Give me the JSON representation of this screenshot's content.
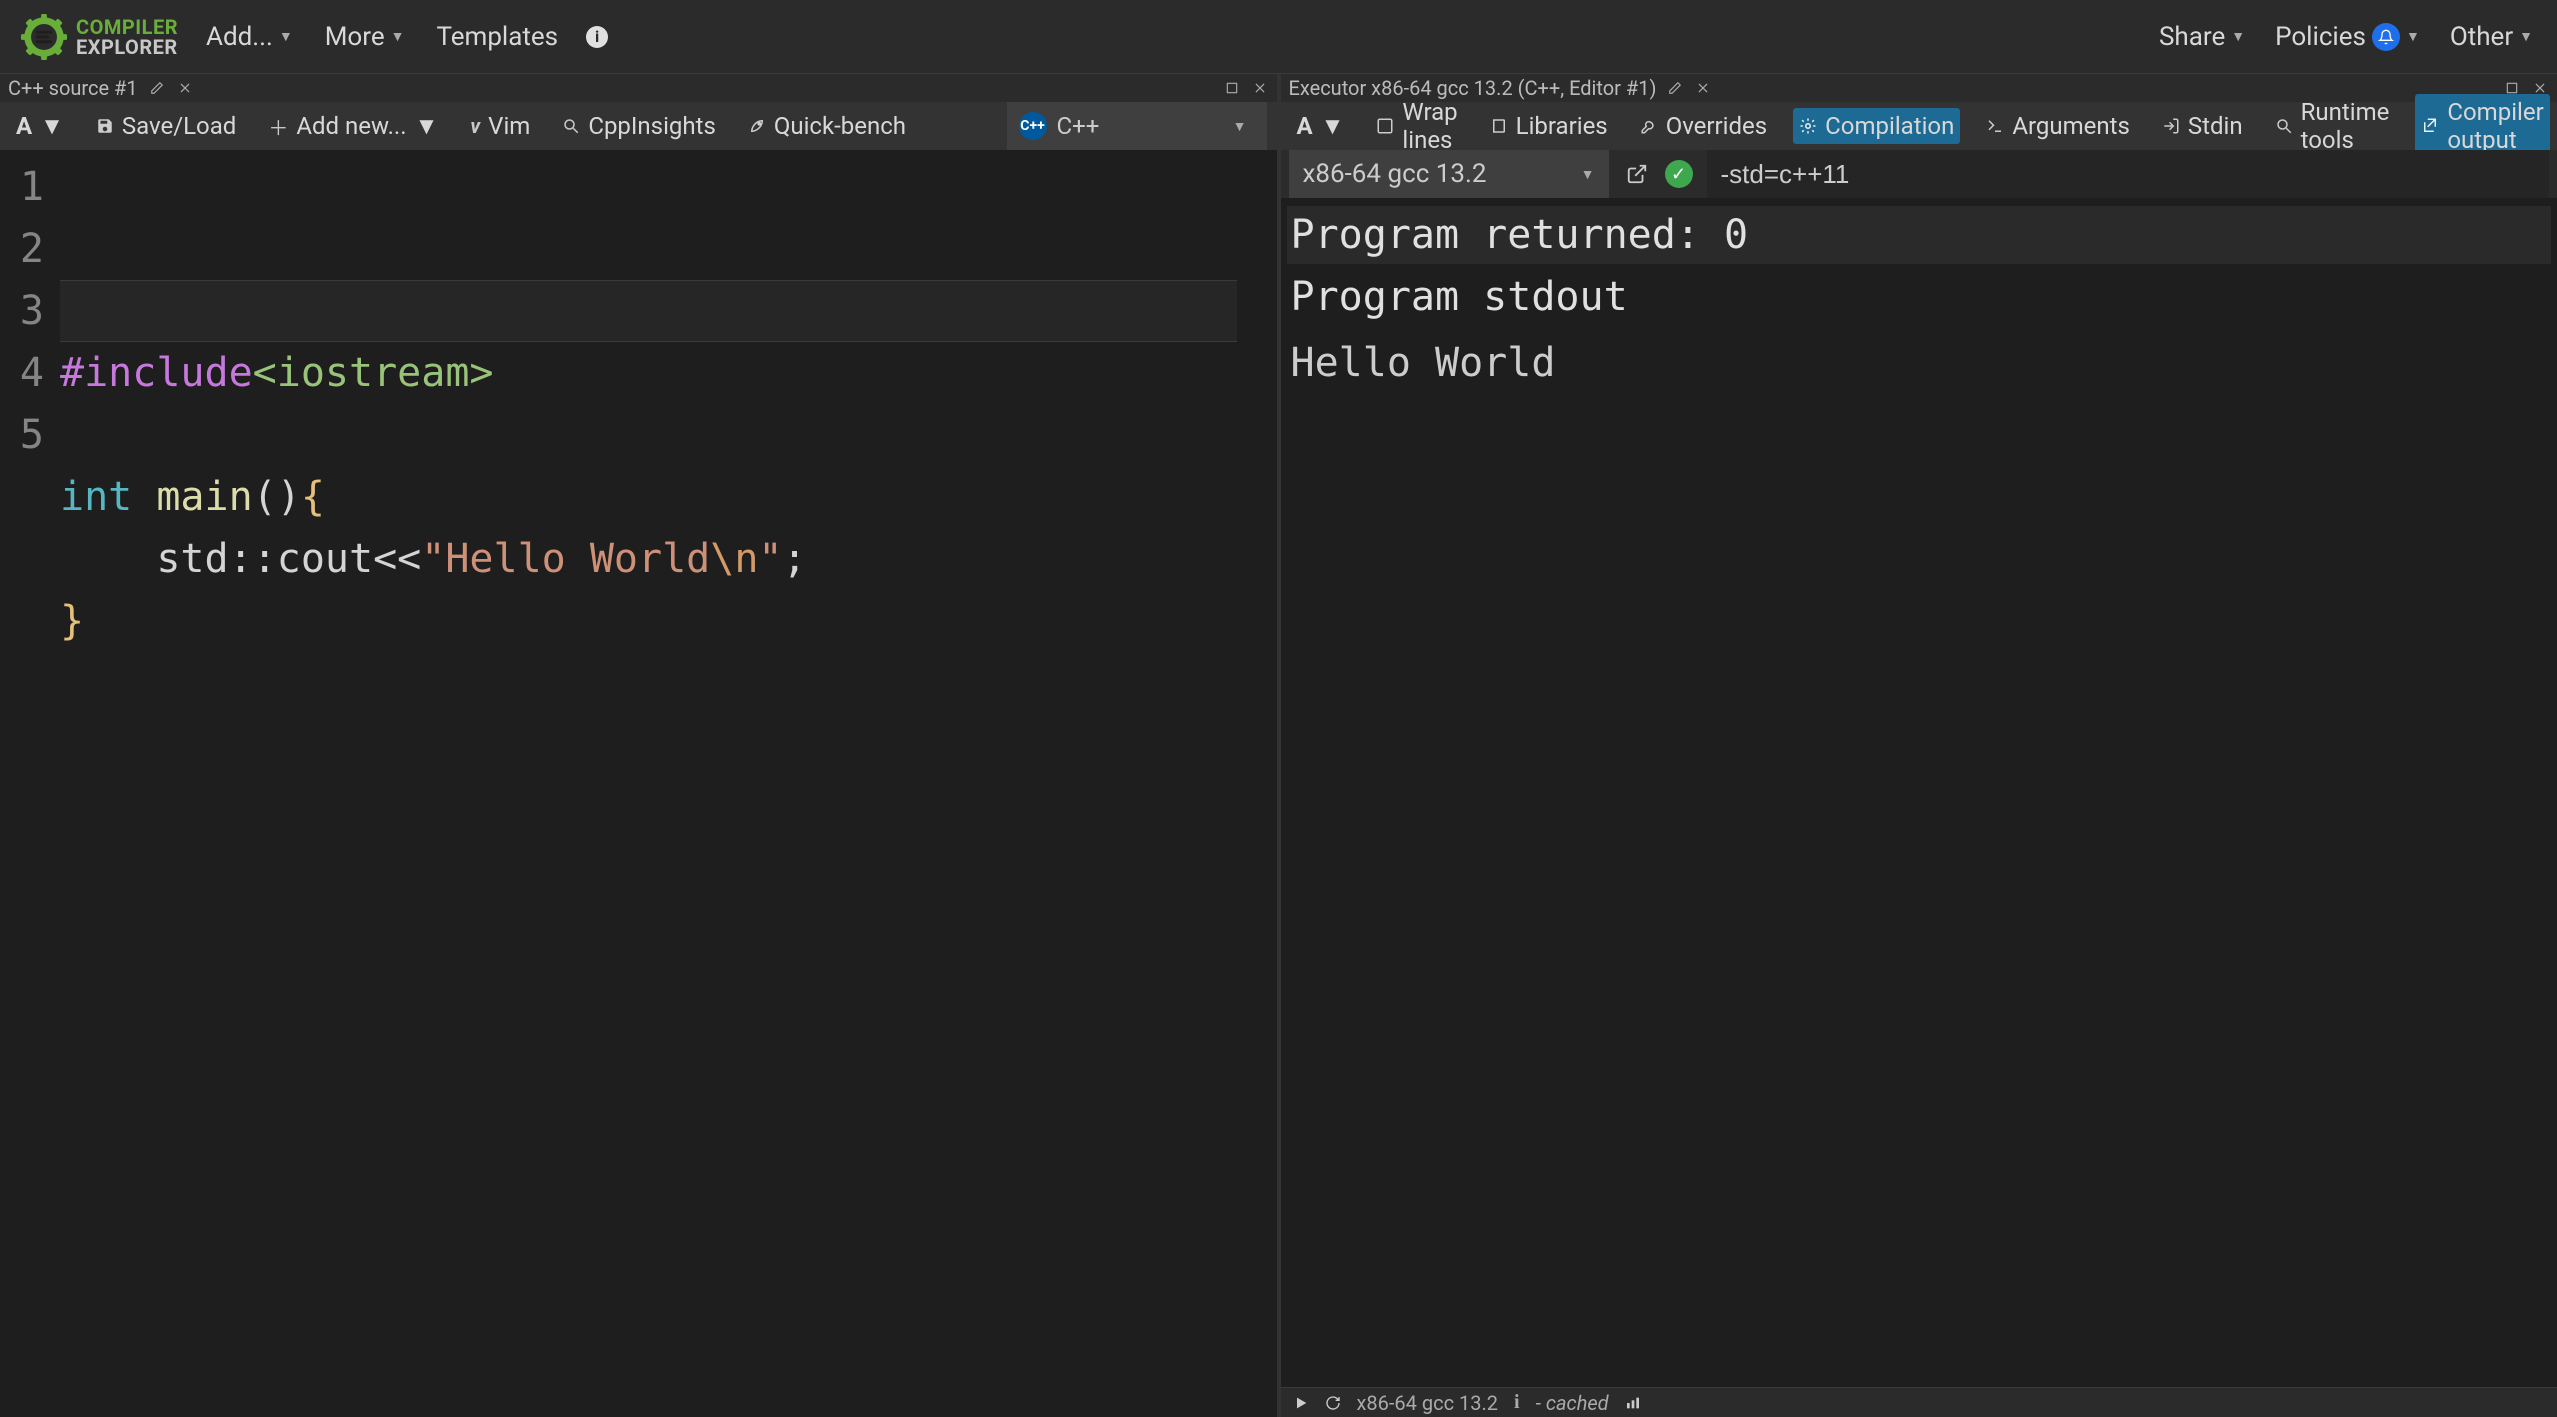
{
  "brand": {
    "name_line1": "COMPILER",
    "name_line2": "EXPLORER"
  },
  "nav": {
    "add": "Add...",
    "more": "More",
    "templates": "Templates",
    "share": "Share",
    "policies": "Policies",
    "other": "Other"
  },
  "left_pane": {
    "tab_title": "C++ source #1",
    "toolbar": {
      "font_label": "A",
      "save_load": "Save/Load",
      "add_new": "Add new...",
      "vim": "Vim",
      "cppinsights": "CppInsights",
      "quick_bench": "Quick-bench"
    },
    "language": "C++",
    "code": {
      "lines": [
        {
          "n": 1,
          "segments": [
            {
              "t": "#include",
              "c": "tok-pre"
            },
            {
              "t": "<iostream>",
              "c": "tok-inc"
            }
          ]
        },
        {
          "n": 2,
          "segments": [
            {
              "t": "",
              "c": ""
            }
          ]
        },
        {
          "n": 3,
          "segments": [
            {
              "t": "int",
              "c": "tok-type"
            },
            {
              "t": " ",
              "c": ""
            },
            {
              "t": "main",
              "c": "tok-fn"
            },
            {
              "t": "()",
              "c": "tok-punc"
            },
            {
              "t": "{",
              "c": "tok-brace"
            }
          ]
        },
        {
          "n": 4,
          "segments": [
            {
              "t": "    std",
              "c": "tok-ns"
            },
            {
              "t": "::",
              "c": "tok-punc"
            },
            {
              "t": "cout",
              "c": "tok-ns"
            },
            {
              "t": "<<",
              "c": "tok-punc"
            },
            {
              "t": "\"Hello World",
              "c": "tok-str"
            },
            {
              "t": "\\n",
              "c": "tok-esc"
            },
            {
              "t": "\"",
              "c": "tok-str"
            },
            {
              "t": ";",
              "c": "tok-punc"
            }
          ]
        },
        {
          "n": 5,
          "segments": [
            {
              "t": "}",
              "c": "tok-brace"
            }
          ]
        }
      ]
    }
  },
  "right_pane": {
    "tab_title": "Executor x86-64 gcc 13.2 (C++, Editor #1)",
    "toolbar": {
      "font_label": "A",
      "wrap_lines": "Wrap lines",
      "libraries": "Libraries",
      "overrides": "Overrides",
      "compilation": "Compilation",
      "arguments": "Arguments",
      "stdin": "Stdin",
      "runtime_tools": "Runtime tools",
      "compiler_output": "Compiler output"
    },
    "compiler": "x86-64 gcc 13.2",
    "options": "-std=c++11",
    "output": {
      "return_line": "Program returned: 0",
      "stdout_heading": "Program stdout",
      "stdout": "Hello World"
    },
    "status": {
      "compiler_short": "x86-64 gcc 13.2",
      "cached_label": "- cached"
    }
  }
}
